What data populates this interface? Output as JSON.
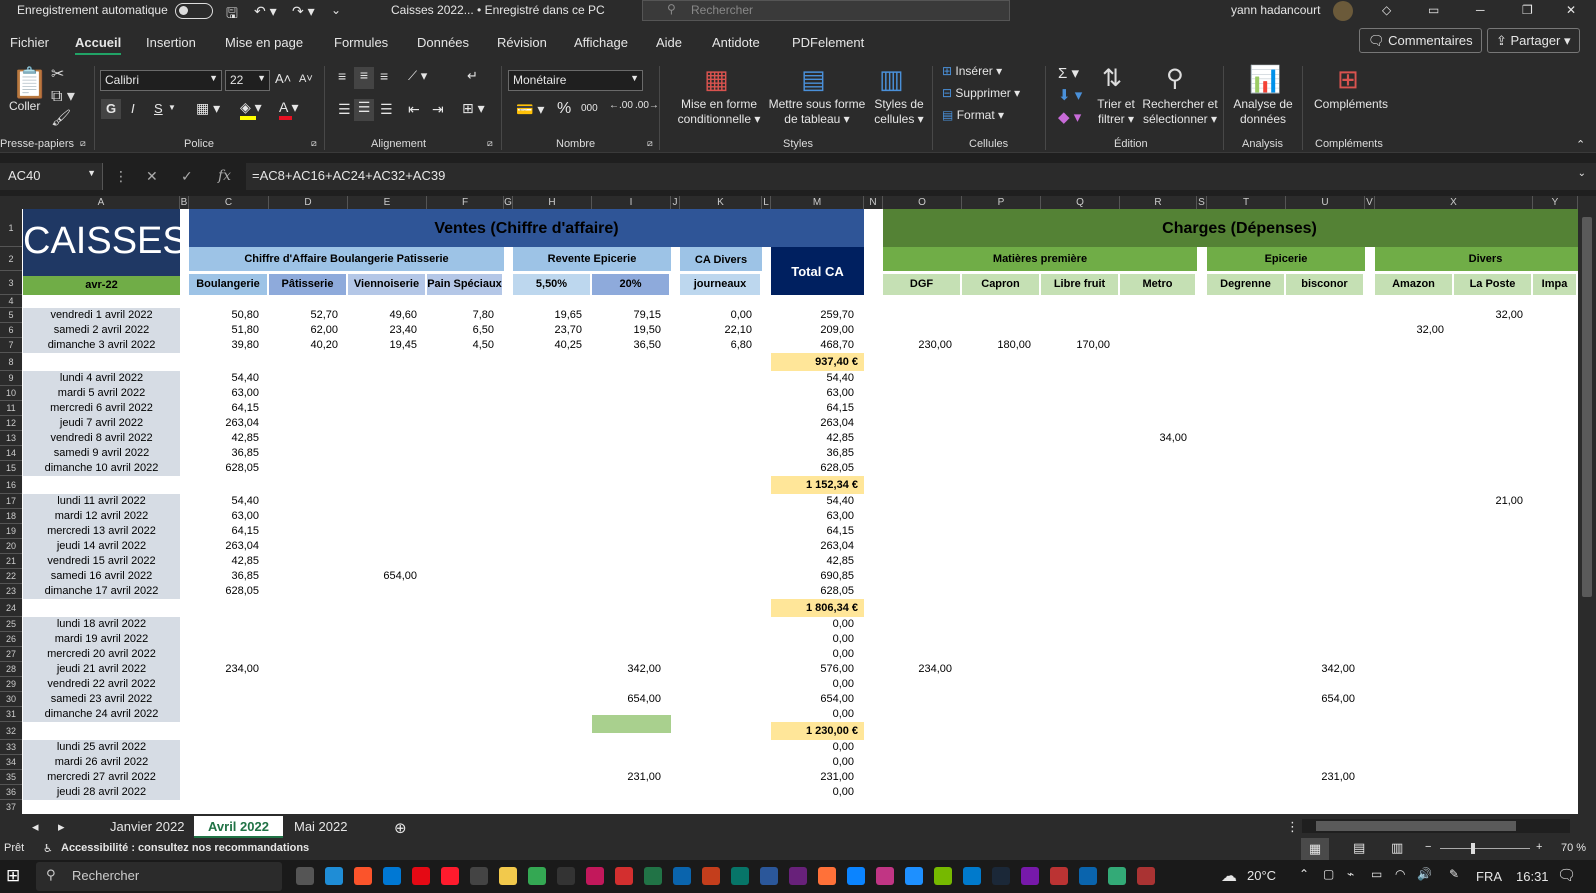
{
  "titlebar": {
    "autosave_label": "Enregistrement automatique",
    "doc_title": "Caisses 2022...  •  Enregistré dans ce PC",
    "search_placeholder": "Rechercher",
    "user": "yann hadancourt"
  },
  "menu": [
    "Fichier",
    "Accueil",
    "Insertion",
    "Mise en page",
    "Formules",
    "Données",
    "Révision",
    "Affichage",
    "Aide",
    "Antidote",
    "PDFelement"
  ],
  "buttons": {
    "comments": "Commentaires",
    "share": "Partager"
  },
  "ribbon": {
    "paste": "Coller",
    "clipboard": "Presse-papiers",
    "font_name": "Calibri",
    "font_size": "22",
    "font_group": "Police",
    "bold": "G",
    "italic": "I",
    "underline": "S",
    "align_group": "Alignement",
    "number_format": "Monétaire",
    "number_group": "Nombre",
    "cond_format": "Mise en forme conditionnelle",
    "as_table": "Mettre sous forme de tableau",
    "cell_styles": "Styles de cellules",
    "styles_group": "Styles",
    "insert": "Insérer",
    "delete": "Supprimer",
    "format": "Format",
    "cells_group": "Cellules",
    "sort": "Trier et filtrer",
    "find": "Rechercher et sélectionner",
    "edit_group": "Édition",
    "analyze": "Analyse de données",
    "analysis_group": "Analysis",
    "addins": "Compléments",
    "addins_group": "Compléments",
    "percent": "%",
    "thousands": "000"
  },
  "formula_bar": {
    "name_box": "AC40",
    "formula": "=AC8+AC16+AC24+AC32+AC39",
    "fx": "fx"
  },
  "columns": [
    "A",
    "B",
    "C",
    "D",
    "E",
    "F",
    "G",
    "H",
    "I",
    "J",
    "K",
    "L",
    "M",
    "N",
    "O",
    "P",
    "Q",
    "R",
    "S",
    "T",
    "U",
    "V",
    "X",
    "Y"
  ],
  "header": {
    "title": "CAISSES",
    "month": "avr-22",
    "ventes": "Ventes (Chiffre d'affaire)",
    "charges": "Charges (Dépenses)",
    "ca_boul": "Chiffre d'Affaire Boulangerie Patisserie",
    "revente": "Revente Epicerie",
    "ca_divers": "CA Divers",
    "total_ca": "Total CA",
    "matieres": "Matières première",
    "epicerie": "Epicerie",
    "divers": "Divers",
    "sub": [
      "Boulangerie",
      "Pâtisserie",
      "Viennoiserie",
      "Pain Spéciaux",
      "5,50%",
      "20%",
      "journeaux",
      "DGF",
      "Capron",
      "Libre fruit",
      "Metro",
      "Degrenne",
      "bisconor",
      "Amazon",
      "La Poste",
      "Impa"
    ]
  },
  "rows": [
    {
      "r": "5",
      "d": "vendredi 1 avril 2022",
      "C": "50,80 ",
      "D": "52,70 ",
      "E": "49,60 ",
      "F": "7,80 ",
      "H": "19,65 ",
      "I": "79,15 ",
      "K": "0,00 ",
      "M": "259,70 ",
      "X": "32,00 "
    },
    {
      "r": "6",
      "d": "samedi 2 avril 2022",
      "C": "51,80 ",
      "D": "62,00 ",
      "E": "23,40 ",
      "F": "6,50 ",
      "H": "23,70 ",
      "I": "19,50 ",
      "K": "22,10 ",
      "M": "209,00 ",
      "V": "32,00 "
    },
    {
      "r": "7",
      "d": "dimanche 3 avril 2022",
      "C": "39,80 ",
      "D": "40,20 ",
      "E": "19,45 ",
      "F": "4,50 ",
      "H": "40,25 ",
      "I": "36,50 ",
      "K": "6,80 ",
      "M": "468,70 ",
      "O": "230,00 ",
      "P": "180,00 ",
      "Q": "170,00 "
    },
    {
      "r": "8",
      "t": "937,40 €"
    },
    {
      "r": "9",
      "d": "lundi 4 avril 2022",
      "C": "54,40 ",
      "M": "54,40 "
    },
    {
      "r": "10",
      "d": "mardi 5 avril 2022",
      "C": "63,00 ",
      "M": "63,00 "
    },
    {
      "r": "11",
      "d": "mercredi 6 avril 2022",
      "C": "64,15 ",
      "M": "64,15 "
    },
    {
      "r": "12",
      "d": "jeudi 7 avril 2022",
      "C": "263,04 ",
      "M": "263,04 "
    },
    {
      "r": "13",
      "d": "vendredi 8 avril 2022",
      "C": "42,85 ",
      "M": "42,85 ",
      "R": "34,00 "
    },
    {
      "r": "14",
      "d": "samedi 9 avril 2022",
      "C": "36,85 ",
      "M": "36,85 "
    },
    {
      "r": "15",
      "d": "dimanche 10 avril 2022",
      "C": "628,05 ",
      "M": "628,05 "
    },
    {
      "r": "16",
      "t": "1 152,34 €"
    },
    {
      "r": "17",
      "d": "lundi 11 avril 2022",
      "C": "54,40 ",
      "M": "54,40 ",
      "X": "21,00 "
    },
    {
      "r": "18",
      "d": "mardi 12 avril 2022",
      "C": "63,00 ",
      "M": "63,00 "
    },
    {
      "r": "19",
      "d": "mercredi 13 avril 2022",
      "C": "64,15 ",
      "M": "64,15 "
    },
    {
      "r": "20",
      "d": "jeudi 14 avril 2022",
      "C": "263,04 ",
      "M": "263,04 "
    },
    {
      "r": "21",
      "d": "vendredi 15 avril 2022",
      "C": "42,85 ",
      "M": "42,85 "
    },
    {
      "r": "22",
      "d": "samedi 16 avril 2022",
      "C": "36,85 ",
      "E": "654,00 ",
      "M": "690,85 "
    },
    {
      "r": "23",
      "d": "dimanche 17 avril 2022",
      "C": "628,05 ",
      "M": "628,05 "
    },
    {
      "r": "24",
      "t": "1 806,34 €"
    },
    {
      "r": "25",
      "d": "lundi 18 avril 2022",
      "M": "0,00 "
    },
    {
      "r": "26",
      "d": "mardi 19 avril 2022",
      "M": "0,00 "
    },
    {
      "r": "27",
      "d": "mercredi 20 avril 2022",
      "M": "0,00 "
    },
    {
      "r": "28",
      "d": "jeudi 21 avril 2022",
      "C": "234,00 ",
      "I": "342,00 ",
      "M": "576,00 ",
      "O": "234,00 ",
      "U": "342,00 "
    },
    {
      "r": "29",
      "d": "vendredi 22 avril 2022",
      "M": "0,00 "
    },
    {
      "r": "30",
      "d": "samedi 23 avril 2022",
      "I": "654,00 ",
      "M": "654,00 ",
      "U": "654,00 "
    },
    {
      "r": "31",
      "d": "dimanche 24 avril 2022",
      "M": "0,00 "
    },
    {
      "r": "32",
      "t": "1 230,00 €"
    },
    {
      "r": "33",
      "d": "lundi 25 avril 2022",
      "M": "0,00 "
    },
    {
      "r": "34",
      "d": "mardi 26 avril 2022",
      "M": "0,00 "
    },
    {
      "r": "35",
      "d": "mercredi 27 avril 2022",
      "I": "231,00 ",
      "M": "231,00 ",
      "U": "231,00 "
    },
    {
      "r": "36",
      "d": "jeudi 28 avril 2022",
      "M": "0,00 "
    }
  ],
  "sheets": [
    "Janvier 2022",
    "Avril 2022",
    "Mai 2022"
  ],
  "status": {
    "ready": "Prêt",
    "accessibility": "Accessibilité : consultez nos recommandations",
    "zoom": "70 %"
  },
  "taskbar": {
    "search": "Rechercher",
    "weather": "20°C",
    "lang": "FRA",
    "time": "16:31"
  }
}
